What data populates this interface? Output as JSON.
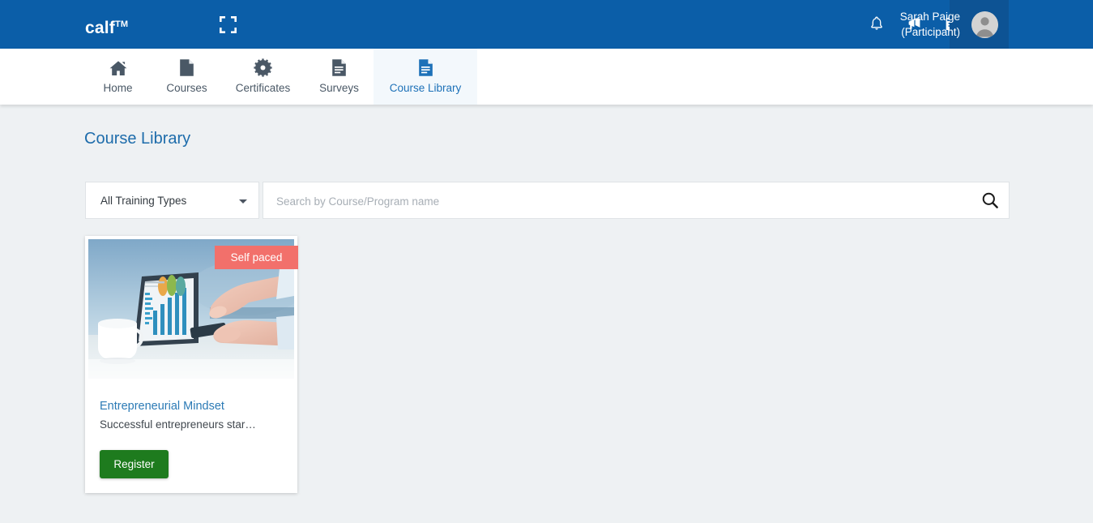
{
  "header": {
    "brand": "calf",
    "brand_tm": "TM",
    "expand_icon": "fullscreen-expand-icon",
    "notifications_icon": "bell-icon",
    "announcements_icon": "megaphone-icon",
    "calendar_icon": "calendar-icon",
    "user_name": "Sarah Paige",
    "user_role": "(Participant)",
    "avatar_icon": "user-avatar-icon",
    "bg_color": "#0b5ea8",
    "panel_color": "#0d5394"
  },
  "nav": {
    "items": [
      {
        "label": "Home",
        "icon": "home-icon",
        "active": false
      },
      {
        "label": "Courses",
        "icon": "page-icon",
        "active": false
      },
      {
        "label": "Certificates",
        "icon": "certificate-badge-icon",
        "active": false
      },
      {
        "label": "Surveys",
        "icon": "document-lines-icon",
        "active": false
      },
      {
        "label": "Course Library",
        "icon": "document-lines-icon",
        "active": true
      }
    ],
    "active_color": "#1d71b8"
  },
  "main": {
    "page_title": "Course Library",
    "filter": {
      "selected": "All Training Types",
      "caret_icon": "chevron-down-icon",
      "options": [
        "All Training Types"
      ]
    },
    "search": {
      "placeholder": "Search by Course/Program name",
      "value": "",
      "icon": "search-icon"
    },
    "cards": [
      {
        "badge": "Self paced",
        "badge_color": "#f2706b",
        "title": "Entrepreneurial Mindset",
        "description": "Successful entrepreneurs star…",
        "button_label": "Register",
        "button_color": "#1e7b1e",
        "thumbnail": "tablet-chart-hands-photo"
      }
    ]
  }
}
